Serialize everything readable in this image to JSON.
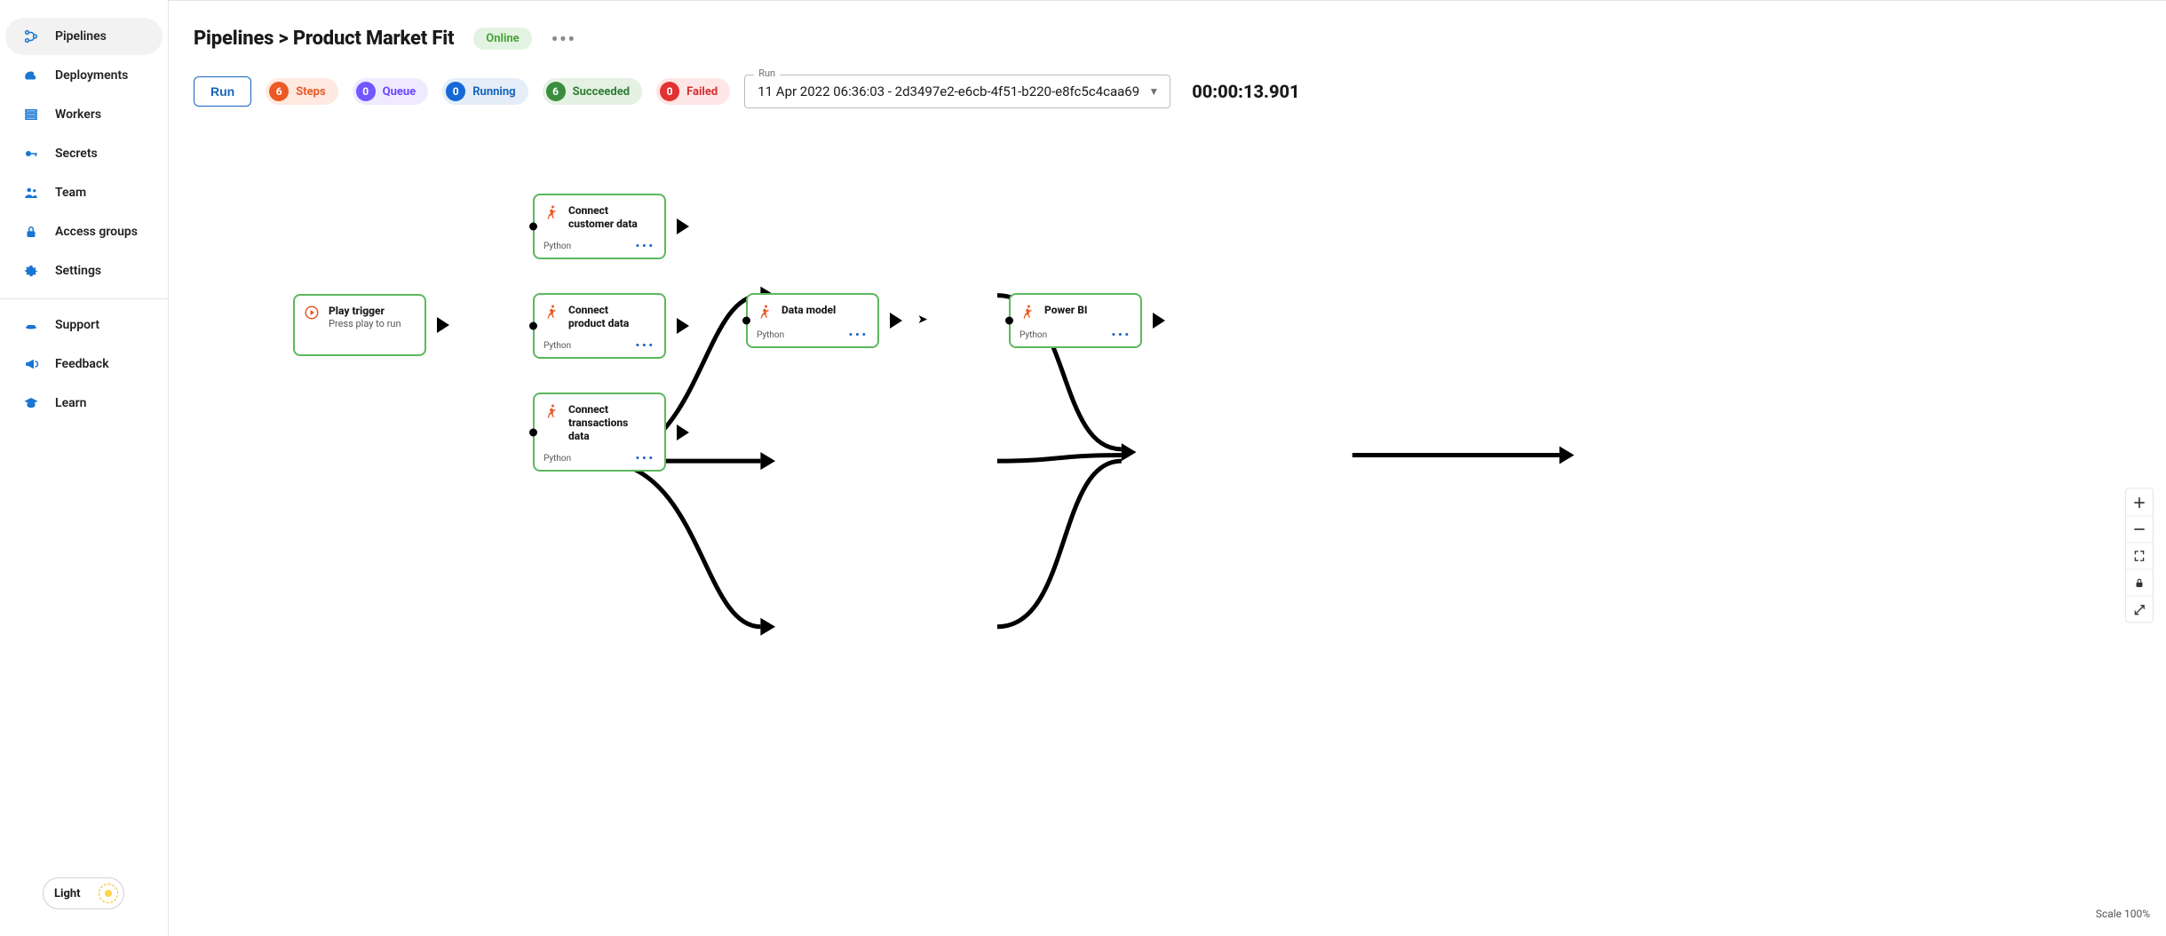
{
  "sidebar": {
    "items": [
      {
        "label": "Pipelines"
      },
      {
        "label": "Deployments"
      },
      {
        "label": "Workers"
      },
      {
        "label": "Secrets"
      },
      {
        "label": "Team"
      },
      {
        "label": "Access groups"
      },
      {
        "label": "Settings"
      }
    ],
    "support_items": [
      {
        "label": "Support"
      },
      {
        "label": "Feedback"
      },
      {
        "label": "Learn"
      }
    ],
    "theme_label": "Light"
  },
  "header": {
    "breadcrumb": "Pipelines > Product Market Fit",
    "status": "Online"
  },
  "toolbar": {
    "run_label": "Run",
    "chips": {
      "steps": {
        "count": "6",
        "label": "Steps"
      },
      "queue": {
        "count": "0",
        "label": "Queue"
      },
      "running": {
        "count": "0",
        "label": "Running"
      },
      "succeeded": {
        "count": "6",
        "label": "Succeeded"
      },
      "failed": {
        "count": "0",
        "label": "Failed"
      }
    },
    "run_select": {
      "legend": "Run",
      "value": "11 Apr 2022 06:36:03 - 2d3497e2-e6cb-4f51-b220-e8fc5c4caa69"
    },
    "duration": "00:00:13.901"
  },
  "canvas": {
    "scale_label": "Scale 100%",
    "nodes": {
      "trigger": {
        "title": "Play trigger",
        "subtitle": "Press play to run"
      },
      "customer": {
        "title": "Connect customer data",
        "lang": "Python"
      },
      "product": {
        "title": "Connect product data",
        "lang": "Python"
      },
      "tx": {
        "title": "Connect transactions data",
        "lang": "Python"
      },
      "model": {
        "title": "Data model",
        "lang": "Python"
      },
      "powerbi": {
        "title": "Power BI",
        "lang": "Python"
      }
    }
  }
}
